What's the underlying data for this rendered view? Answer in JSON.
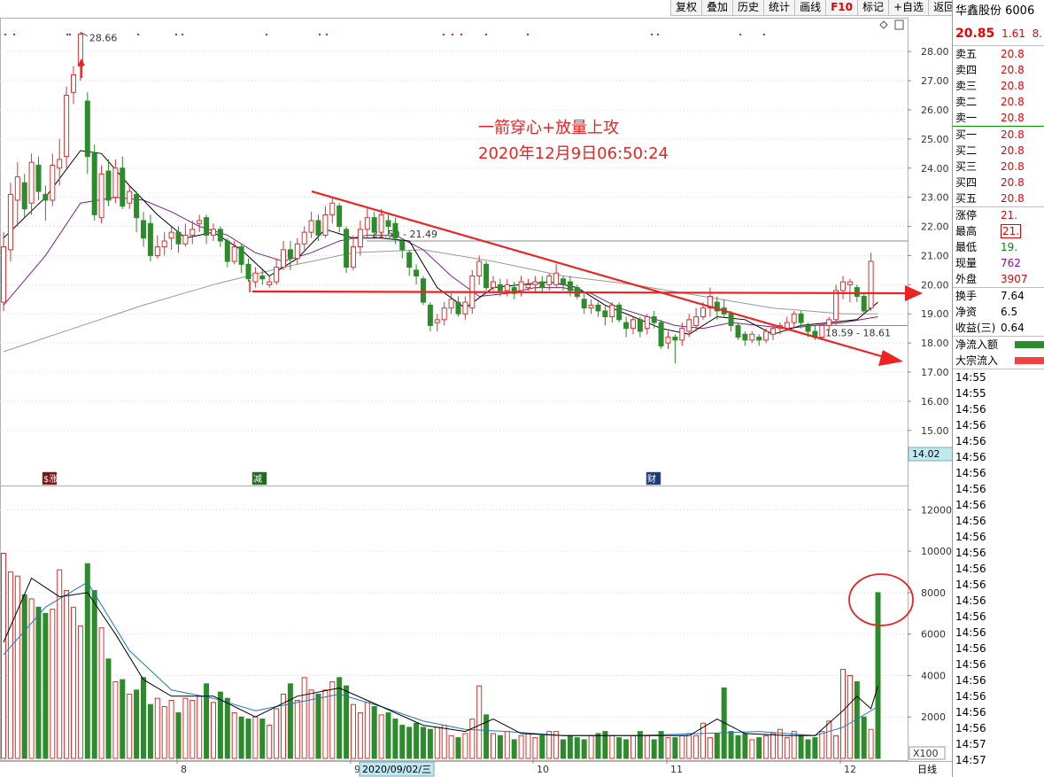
{
  "toolbar": {
    "buttons": [
      "复权",
      "叠加",
      "历史",
      "统计",
      "画线",
      "F10",
      "标记",
      "+自选",
      "返回"
    ]
  },
  "colors": {
    "up": "#e03030",
    "down": "#2c8c2c",
    "ma5": "#000000",
    "ma10": "#7a1f9a",
    "ma20": "#999999",
    "vol_ma": "#1f78c8",
    "annotation": "#ee2222"
  },
  "annotation": {
    "line1": "一箭穿心+放量上攻",
    "line2": "2020年12月9日06:50:24"
  },
  "price_labels": {
    "high_label": "28.66",
    "range_upper": "21.50 - 21.49",
    "range_lower": "18.59 - 18.61",
    "bottom_readout": "14.02"
  },
  "markers": {
    "m1": "$涨",
    "m2": "减",
    "m3": "财"
  },
  "chart_data": {
    "type": "candlestick",
    "period_label": "日线",
    "x_tick_labels": [
      "8",
      "9",
      "10",
      "11",
      "12"
    ],
    "cursor_date_label": "2020/09/02/三",
    "price_axis": {
      "ticks": [
        15.0,
        16.0,
        17.0,
        18.0,
        19.0,
        20.0,
        21.0,
        22.0,
        23.0,
        24.0,
        25.0,
        26.0,
        27.0,
        28.0
      ],
      "range": [
        13.9,
        29.1
      ]
    },
    "volume_axis": {
      "ticks": [
        2000,
        4000,
        6000,
        8000,
        10000,
        12000
      ],
      "range": [
        0,
        13000
      ],
      "unit": "X100"
    },
    "candles": [
      [
        19.4,
        21.3,
        19.1,
        21.8
      ],
      [
        21.2,
        23.1,
        20.8,
        23.5
      ],
      [
        22.9,
        23.7,
        22.0,
        24.2
      ],
      [
        23.5,
        22.6,
        22.3,
        23.8
      ],
      [
        22.8,
        24.2,
        22.4,
        24.5
      ],
      [
        24.1,
        23.2,
        22.9,
        24.4
      ],
      [
        23.1,
        22.9,
        22.2,
        23.4
      ],
      [
        22.9,
        24.1,
        22.7,
        24.5
      ],
      [
        24.0,
        24.3,
        23.4,
        25.0
      ],
      [
        24.4,
        26.5,
        24.0,
        26.8
      ],
      [
        26.6,
        27.2,
        26.2,
        27.5
      ],
      [
        27.5,
        28.6,
        27.0,
        28.66
      ],
      [
        26.3,
        24.4,
        23.8,
        26.6
      ],
      [
        24.5,
        22.4,
        22.2,
        24.8
      ],
      [
        22.3,
        23.8,
        22.1,
        24.1
      ],
      [
        23.9,
        22.9,
        22.7,
        24.3
      ],
      [
        23.0,
        24.0,
        22.8,
        24.3
      ],
      [
        24.0,
        22.7,
        22.6,
        24.4
      ],
      [
        22.8,
        23.2,
        22.6,
        23.4
      ],
      [
        23.1,
        22.3,
        21.8,
        23.2
      ],
      [
        22.2,
        21.6,
        21.3,
        22.5
      ],
      [
        22.1,
        21.0,
        20.8,
        22.4
      ],
      [
        21.0,
        21.3,
        20.9,
        21.7
      ],
      [
        21.3,
        21.5,
        21.0,
        21.8
      ],
      [
        21.6,
        21.8,
        21.2,
        22.0
      ],
      [
        21.8,
        21.4,
        21.1,
        22.0
      ],
      [
        21.4,
        21.7,
        21.3,
        22.1
      ],
      [
        21.7,
        21.9,
        21.4,
        22.2
      ],
      [
        22.1,
        22.2,
        21.8,
        22.4
      ],
      [
        22.3,
        21.7,
        21.4,
        22.4
      ],
      [
        21.7,
        21.9,
        21.5,
        22.1
      ],
      [
        21.9,
        21.5,
        21.3,
        22.0
      ],
      [
        21.5,
        20.8,
        20.6,
        21.6
      ],
      [
        20.8,
        21.3,
        20.7,
        21.5
      ],
      [
        21.3,
        20.7,
        20.4,
        21.4
      ],
      [
        20.7,
        20.2,
        20.1,
        20.9
      ],
      [
        20.1,
        20.4,
        19.9,
        20.6
      ],
      [
        20.3,
        20.2,
        20.0,
        20.5
      ],
      [
        20.0,
        20.1,
        19.9,
        20.3
      ],
      [
        20.1,
        20.6,
        20.0,
        20.9
      ],
      [
        20.6,
        21.2,
        20.5,
        21.5
      ],
      [
        21.2,
        20.9,
        20.5,
        21.5
      ],
      [
        20.9,
        21.4,
        20.7,
        21.6
      ],
      [
        21.4,
        21.8,
        21.2,
        22.0
      ],
      [
        21.8,
        22.2,
        21.6,
        22.5
      ],
      [
        22.2,
        21.7,
        21.5,
        22.4
      ],
      [
        21.7,
        22.4,
        21.6,
        22.7
      ],
      [
        22.4,
        22.8,
        22.1,
        23.0
      ],
      [
        22.7,
        22.0,
        21.8,
        22.8
      ],
      [
        21.9,
        20.6,
        20.4,
        22.0
      ],
      [
        20.6,
        21.3,
        20.5,
        21.7
      ],
      [
        21.3,
        21.9,
        21.0,
        22.2
      ],
      [
        21.9,
        22.3,
        21.6,
        22.6
      ],
      [
        22.3,
        21.8,
        21.7,
        22.5
      ],
      [
        21.8,
        22.4,
        21.6,
        22.6
      ],
      [
        22.2,
        22.0,
        21.7,
        22.4
      ],
      [
        22.1,
        21.6,
        21.4,
        22.3
      ],
      [
        21.5,
        21.2,
        20.9,
        21.6
      ],
      [
        21.1,
        20.6,
        20.3,
        21.2
      ],
      [
        20.5,
        20.3,
        20.0,
        20.7
      ],
      [
        20.2,
        19.4,
        19.3,
        20.3
      ],
      [
        19.3,
        18.6,
        18.4,
        19.4
      ],
      [
        18.7,
        18.8,
        18.4,
        19.0
      ],
      [
        18.8,
        19.2,
        18.6,
        19.4
      ],
      [
        19.2,
        19.5,
        19.0,
        19.7
      ],
      [
        19.4,
        19.0,
        18.9,
        19.6
      ],
      [
        19.0,
        19.4,
        18.8,
        19.6
      ],
      [
        19.2,
        20.3,
        19.0,
        20.5
      ],
      [
        20.3,
        20.8,
        20.0,
        21.0
      ],
      [
        20.7,
        19.9,
        19.8,
        20.8
      ],
      [
        19.9,
        20.1,
        19.8,
        20.3
      ],
      [
        20.0,
        19.8,
        19.6,
        20.2
      ],
      [
        19.8,
        20.0,
        19.6,
        20.2
      ],
      [
        19.9,
        19.7,
        19.5,
        20.1
      ],
      [
        19.8,
        20.1,
        19.6,
        20.3
      ],
      [
        19.9,
        20.0,
        19.8,
        20.2
      ],
      [
        20.0,
        20.1,
        19.7,
        20.3
      ],
      [
        20.1,
        19.9,
        19.7,
        20.3
      ],
      [
        20.0,
        20.3,
        19.8,
        20.4
      ],
      [
        20.0,
        20.4,
        19.9,
        20.7
      ],
      [
        20.2,
        20.0,
        19.8,
        20.3
      ],
      [
        20.1,
        19.8,
        19.6,
        20.3
      ],
      [
        19.9,
        19.6,
        19.5,
        20.0
      ],
      [
        19.5,
        19.2,
        19.0,
        19.7
      ],
      [
        19.2,
        19.3,
        19.0,
        19.5
      ],
      [
        19.3,
        19.1,
        18.9,
        19.4
      ],
      [
        19.1,
        18.9,
        18.6,
        19.3
      ],
      [
        18.9,
        19.3,
        18.7,
        19.4
      ],
      [
        19.3,
        18.8,
        18.7,
        19.4
      ],
      [
        18.7,
        18.5,
        18.2,
        18.9
      ],
      [
        18.5,
        18.8,
        18.3,
        18.9
      ],
      [
        18.8,
        18.4,
        18.2,
        18.9
      ],
      [
        18.5,
        18.9,
        18.3,
        19.0
      ],
      [
        18.9,
        18.7,
        18.5,
        19.1
      ],
      [
        18.7,
        17.9,
        17.8,
        18.8
      ],
      [
        18.0,
        18.2,
        17.8,
        18.4
      ],
      [
        18.2,
        18.1,
        17.3,
        18.3
      ],
      [
        18.1,
        18.5,
        17.9,
        18.7
      ],
      [
        18.4,
        18.8,
        18.2,
        19.0
      ],
      [
        18.6,
        18.9,
        18.4,
        19.2
      ],
      [
        18.9,
        19.2,
        18.8,
        19.4
      ],
      [
        19.2,
        19.6,
        18.9,
        19.9
      ],
      [
        19.4,
        19.1,
        18.8,
        19.6
      ],
      [
        19.2,
        19.0,
        18.9,
        19.5
      ],
      [
        19.0,
        18.6,
        18.4,
        19.1
      ],
      [
        18.6,
        18.2,
        18.1,
        18.7
      ],
      [
        18.3,
        18.1,
        17.9,
        18.4
      ],
      [
        18.1,
        18.3,
        18.0,
        18.4
      ],
      [
        18.2,
        18.1,
        17.9,
        18.3
      ],
      [
        18.1,
        18.4,
        18.0,
        18.5
      ],
      [
        18.3,
        18.5,
        18.1,
        18.6
      ],
      [
        18.5,
        18.6,
        18.3,
        18.7
      ],
      [
        18.5,
        18.7,
        18.4,
        18.9
      ],
      [
        18.7,
        19.0,
        18.5,
        19.1
      ],
      [
        19.0,
        18.7,
        18.5,
        19.1
      ],
      [
        18.6,
        18.4,
        18.2,
        18.7
      ],
      [
        18.4,
        18.2,
        18.1,
        18.6
      ],
      [
        18.2,
        18.6,
        18.1,
        18.7
      ],
      [
        18.6,
        18.8,
        18.4,
        18.9
      ],
      [
        18.8,
        19.8,
        18.6,
        20.0
      ],
      [
        19.8,
        20.1,
        19.5,
        20.3
      ],
      [
        20.0,
        20.1,
        19.4,
        20.2
      ],
      [
        19.9,
        19.6,
        19.4,
        20.0
      ],
      [
        19.6,
        19.1,
        19.0,
        19.7
      ],
      [
        19.2,
        20.8,
        19.1,
        21.1
      ]
    ],
    "ma5": [
      [
        0,
        21.6
      ],
      [
        6,
        23.0
      ],
      [
        11,
        24.6
      ],
      [
        14,
        24.5
      ],
      [
        18,
        23.4
      ],
      [
        22,
        22.4
      ],
      [
        26,
        21.6
      ],
      [
        30,
        21.8
      ],
      [
        34,
        21.2
      ],
      [
        38,
        20.3
      ],
      [
        42,
        20.9
      ],
      [
        46,
        21.9
      ],
      [
        50,
        21.6
      ],
      [
        54,
        21.6
      ],
      [
        58,
        21.5
      ],
      [
        62,
        19.9
      ],
      [
        66,
        19.2
      ],
      [
        70,
        19.9
      ],
      [
        74,
        20.0
      ],
      [
        78,
        20.1
      ],
      [
        82,
        19.9
      ],
      [
        86,
        19.3
      ],
      [
        90,
        18.9
      ],
      [
        94,
        18.5
      ],
      [
        98,
        18.3
      ],
      [
        102,
        18.9
      ],
      [
        106,
        18.8
      ],
      [
        110,
        18.3
      ],
      [
        114,
        18.6
      ],
      [
        118,
        18.7
      ],
      [
        122,
        18.8
      ],
      [
        125,
        19.4
      ]
    ],
    "ma10": [
      [
        0,
        19.3
      ],
      [
        6,
        21.0
      ],
      [
        11,
        22.8
      ],
      [
        16,
        23.0
      ],
      [
        20,
        22.9
      ],
      [
        24,
        22.5
      ],
      [
        28,
        22.0
      ],
      [
        32,
        21.7
      ],
      [
        36,
        21.1
      ],
      [
        40,
        20.8
      ],
      [
        44,
        21.1
      ],
      [
        48,
        21.5
      ],
      [
        52,
        21.7
      ],
      [
        56,
        21.7
      ],
      [
        60,
        21.2
      ],
      [
        64,
        20.3
      ],
      [
        68,
        19.6
      ],
      [
        72,
        19.7
      ],
      [
        76,
        19.9
      ],
      [
        80,
        19.9
      ],
      [
        84,
        19.7
      ],
      [
        88,
        19.2
      ],
      [
        92,
        18.9
      ],
      [
        96,
        18.6
      ],
      [
        100,
        18.5
      ],
      [
        104,
        18.7
      ],
      [
        108,
        18.6
      ],
      [
        112,
        18.5
      ],
      [
        116,
        18.6
      ],
      [
        120,
        18.7
      ],
      [
        125,
        18.9
      ]
    ],
    "ma20": [
      [
        0,
        17.7
      ],
      [
        10,
        18.5
      ],
      [
        20,
        19.3
      ],
      [
        30,
        20.0
      ],
      [
        40,
        20.6
      ],
      [
        50,
        21.1
      ],
      [
        60,
        21.2
      ],
      [
        70,
        20.8
      ],
      [
        80,
        20.3
      ],
      [
        90,
        20.0
      ],
      [
        100,
        19.6
      ],
      [
        110,
        19.2
      ],
      [
        120,
        19.0
      ],
      [
        125,
        19.0
      ]
    ],
    "volumes": [
      9900,
      9000,
      8800,
      7900,
      7700,
      7300,
      7000,
      7200,
      9100,
      8100,
      7300,
      6400,
      9400,
      8100,
      6300,
      4800,
      3700,
      3800,
      3100,
      3300,
      3900,
      2600,
      2900,
      2500,
      2800,
      2200,
      2900,
      2800,
      3000,
      3600,
      2700,
      3200,
      2900,
      2200,
      2000,
      1900,
      2000,
      1900,
      1600,
      2400,
      3100,
      3600,
      2800,
      3900,
      3300,
      3100,
      3300,
      3700,
      3900,
      3500,
      2600,
      2200,
      2700,
      2500,
      2100,
      2200,
      1900,
      1600,
      1500,
      1700,
      1500,
      1400,
      1500,
      1600,
      1100,
      1000,
      1200,
      1900,
      3500,
      2100,
      1200,
      1100,
      1300,
      900,
      1100,
      1200,
      1000,
      1100,
      1300,
      1300,
      900,
      1100,
      1000,
      900,
      1100,
      1200,
      1300,
      1100,
      1000,
      900,
      1100,
      1300,
      1100,
      900,
      1300,
      1000,
      1000,
      1100,
      1200,
      1100,
      1700,
      1000,
      1200,
      3400,
      1300,
      1100,
      1200,
      900,
      1000,
      1100,
      1200,
      1400,
      1000,
      1300,
      1100,
      900,
      1000,
      1300,
      1800,
      1100,
      4300,
      4000,
      3700,
      2000,
      1400,
      8000
    ],
    "vol_ma5": [
      [
        0,
        5600
      ],
      [
        4,
        8700
      ],
      [
        8,
        7800
      ],
      [
        12,
        8000
      ],
      [
        16,
        6000
      ],
      [
        20,
        3800
      ],
      [
        24,
        3000
      ],
      [
        30,
        3000
      ],
      [
        36,
        2000
      ],
      [
        42,
        3000
      ],
      [
        48,
        3400
      ],
      [
        54,
        2500
      ],
      [
        60,
        1600
      ],
      [
        66,
        1300
      ],
      [
        70,
        1900
      ],
      [
        74,
        1200
      ],
      [
        80,
        1100
      ],
      [
        86,
        1100
      ],
      [
        92,
        1100
      ],
      [
        98,
        1100
      ],
      [
        102,
        1900
      ],
      [
        106,
        1200
      ],
      [
        112,
        1100
      ],
      [
        116,
        1100
      ],
      [
        120,
        2300
      ],
      [
        122,
        3000
      ],
      [
        124,
        2400
      ],
      [
        125,
        3500
      ]
    ],
    "vol_ma10": [
      [
        0,
        5000
      ],
      [
        6,
        7300
      ],
      [
        12,
        8500
      ],
      [
        18,
        5200
      ],
      [
        24,
        3300
      ],
      [
        30,
        2900
      ],
      [
        36,
        2300
      ],
      [
        42,
        2700
      ],
      [
        48,
        3100
      ],
      [
        54,
        2500
      ],
      [
        60,
        1800
      ],
      [
        66,
        1400
      ],
      [
        72,
        1300
      ],
      [
        80,
        1100
      ],
      [
        90,
        1100
      ],
      [
        100,
        1200
      ],
      [
        108,
        1300
      ],
      [
        116,
        1100
      ],
      [
        120,
        1500
      ],
      [
        125,
        2500
      ]
    ],
    "series": [
      {
        "name": "",
        "values": []
      }
    ]
  },
  "quote": {
    "name": "华鑫股份 6006",
    "price": "20.85",
    "change": "1.61",
    "pct": "8.",
    "asks": [
      {
        "label": "卖五",
        "value": "20.8"
      },
      {
        "label": "卖四",
        "value": "20.8"
      },
      {
        "label": "卖三",
        "value": "20.8"
      },
      {
        "label": "卖二",
        "value": "20.8"
      },
      {
        "label": "卖一",
        "value": "20.8"
      }
    ],
    "bids": [
      {
        "label": "买一",
        "value": "20.8"
      },
      {
        "label": "买二",
        "value": "20.8"
      },
      {
        "label": "买三",
        "value": "20.8"
      },
      {
        "label": "买四",
        "value": "20.8"
      },
      {
        "label": "买五",
        "value": "20.8"
      }
    ],
    "stats": [
      {
        "label": "涨停",
        "value": "21.",
        "cls": ""
      },
      {
        "label": "最高",
        "value": "21.",
        "cls": "box"
      },
      {
        "label": "最低",
        "value": "19.",
        "cls": "green"
      },
      {
        "label": "现量",
        "value": "762",
        "cls": "vol"
      },
      {
        "label": "外盘",
        "value": "3907",
        "cls": ""
      }
    ],
    "stats2": [
      {
        "label": "换手",
        "value": "7.64",
        "cls": "black"
      },
      {
        "label": "净资",
        "value": "6.5",
        "cls": "black"
      },
      {
        "label": "收益(三)",
        "value": "0.64",
        "cls": "black"
      }
    ],
    "flows": [
      {
        "label": "净流入额",
        "color": "#2c8c2c"
      },
      {
        "label": "大宗流入",
        "color": "#ee4444"
      }
    ],
    "ticks": [
      "14:55",
      "14:55",
      "14:56",
      "14:56",
      "14:56",
      "14:56",
      "14:56",
      "14:56",
      "14:56",
      "14:56",
      "14:56",
      "14:56",
      "14:56",
      "14:56",
      "14:56",
      "14:56",
      "14:56",
      "14:56",
      "14:56",
      "14:56",
      "14:56",
      "14:56",
      "14:56",
      "14:57",
      "14:57"
    ]
  }
}
